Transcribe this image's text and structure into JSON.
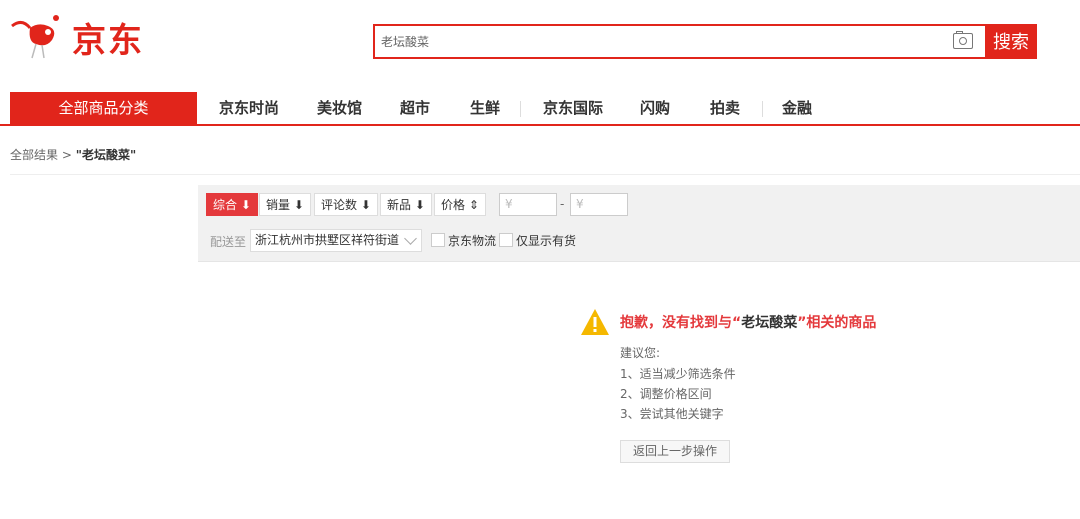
{
  "header": {
    "logo_text": "京东",
    "search": {
      "value": "老坛酸菜",
      "button_label": "搜索"
    }
  },
  "nav": {
    "all_categories": "全部商品分类",
    "items": [
      "京东时尚",
      "美妆馆",
      "超市",
      "生鲜",
      "京东国际",
      "闪购",
      "拍卖",
      "金融"
    ]
  },
  "breadcrumb": {
    "root": "全部结果",
    "separator": ">",
    "keyword": "\"老坛酸菜\""
  },
  "filter": {
    "sorts": [
      "综合 ⬇",
      "销量 ⬇",
      "评论数 ⬇",
      "新品 ⬇",
      "价格 ⇕"
    ],
    "price_min_placeholder": "¥",
    "price_max_placeholder": "¥",
    "price_dash": "-",
    "deliver_label": "配送至",
    "deliver_value": "浙江杭州市拱墅区祥符街道",
    "checkbox_jd_logistics": "京东物流",
    "checkbox_in_stock": "仅显示有货"
  },
  "notice": {
    "title_prefix": "抱歉，没有找到与“",
    "title_keyword": "老坛酸菜",
    "title_suffix": "”相关的商品",
    "suggest_title": "建议您:",
    "suggestions": [
      "1、适当减少筛选条件",
      "2、调整价格区间",
      "3、尝试其他关键字"
    ],
    "back_button": "返回上一步操作"
  },
  "colors": {
    "brand_red": "#e1251b",
    "warning_yellow": "#f5b800"
  }
}
